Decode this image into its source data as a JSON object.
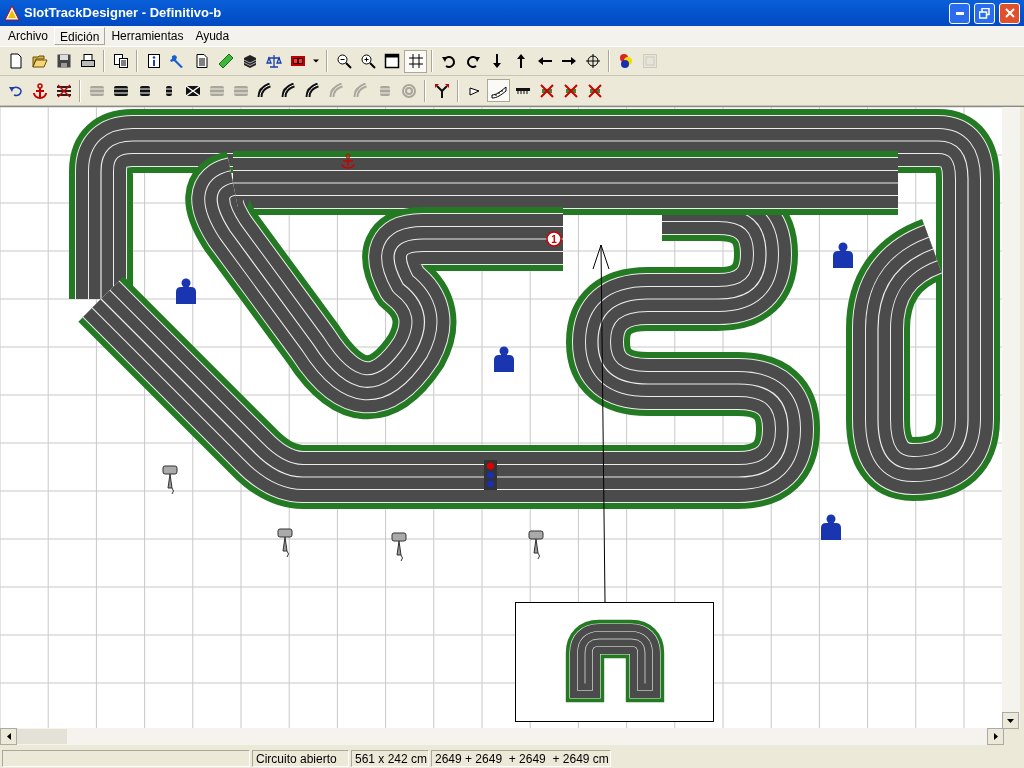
{
  "window": {
    "title": "SlotTrackDesigner - Definitivo-b"
  },
  "menu": [
    {
      "label": "Archivo",
      "selected": false
    },
    {
      "label": "Edición",
      "selected": true
    },
    {
      "label": "Herramientas",
      "selected": false
    },
    {
      "label": "Ayuda",
      "selected": false
    }
  ],
  "toolbars": [
    [
      {
        "kind": "new",
        "disabled": false,
        "selected": false
      },
      {
        "kind": "open",
        "disabled": false,
        "selected": false
      },
      {
        "kind": "save",
        "disabled": false,
        "selected": false
      },
      {
        "kind": "print",
        "disabled": false,
        "selected": false
      },
      {
        "kind": "separator"
      },
      {
        "kind": "copy",
        "disabled": false,
        "selected": false
      },
      {
        "kind": "separator"
      },
      {
        "kind": "info",
        "disabled": false,
        "selected": false
      },
      {
        "kind": "wrench",
        "disabled": false,
        "selected": false
      },
      {
        "kind": "document",
        "disabled": false,
        "selected": false
      },
      {
        "kind": "ruler",
        "disabled": false,
        "selected": false
      },
      {
        "kind": "layers",
        "disabled": false,
        "selected": false
      },
      {
        "kind": "scales",
        "disabled": false,
        "selected": false
      },
      {
        "kind": "timer",
        "disabled": false,
        "selected": false
      },
      {
        "kind": "dropdown",
        "disabled": false,
        "selected": false
      },
      {
        "kind": "separator"
      },
      {
        "kind": "zoom-out",
        "disabled": false,
        "selected": false
      },
      {
        "kind": "zoom-in",
        "disabled": false,
        "selected": false
      },
      {
        "kind": "window",
        "disabled": false,
        "selected": false
      },
      {
        "kind": "grid",
        "disabled": false,
        "selected": true
      },
      {
        "kind": "separator"
      },
      {
        "kind": "rotate-left",
        "disabled": false,
        "selected": false
      },
      {
        "kind": "rotate-right",
        "disabled": false,
        "selected": false
      },
      {
        "kind": "down",
        "disabled": false,
        "selected": false
      },
      {
        "kind": "up",
        "disabled": false,
        "selected": false
      },
      {
        "kind": "left",
        "disabled": false,
        "selected": false
      },
      {
        "kind": "right",
        "disabled": false,
        "selected": false
      },
      {
        "kind": "crosshair",
        "disabled": false,
        "selected": false
      },
      {
        "kind": "separator"
      },
      {
        "kind": "colors",
        "disabled": false,
        "selected": false
      },
      {
        "kind": "picture",
        "disabled": true,
        "selected": false
      }
    ],
    [
      {
        "kind": "undo",
        "disabled": false,
        "selected": false
      },
      {
        "kind": "anchor",
        "disabled": false,
        "selected": false
      },
      {
        "kind": "crossed",
        "disabled": false,
        "selected": false
      },
      {
        "kind": "separator"
      },
      {
        "kind": "lanes",
        "disabled": true,
        "selected": false
      },
      {
        "kind": "lanes",
        "disabled": false,
        "selected": false
      },
      {
        "kind": "lanes-narrow",
        "disabled": false,
        "selected": false
      },
      {
        "kind": "lanes-thin",
        "disabled": false,
        "selected": false
      },
      {
        "kind": "crossover",
        "disabled": false,
        "selected": false
      },
      {
        "kind": "lanes",
        "disabled": true,
        "selected": false
      },
      {
        "kind": "lanes",
        "disabled": true,
        "selected": false
      },
      {
        "kind": "curve",
        "disabled": false,
        "selected": false
      },
      {
        "kind": "curve",
        "disabled": false,
        "selected": false
      },
      {
        "kind": "curve",
        "disabled": false,
        "selected": false
      },
      {
        "kind": "curve",
        "disabled": true,
        "selected": false
      },
      {
        "kind": "curve",
        "disabled": true,
        "selected": false
      },
      {
        "kind": "lanes-narrow",
        "disabled": true,
        "selected": false
      },
      {
        "kind": "circles",
        "disabled": true,
        "selected": false
      },
      {
        "kind": "separator"
      },
      {
        "kind": "fork",
        "disabled": false,
        "selected": false
      },
      {
        "kind": "separator"
      },
      {
        "kind": "pennant",
        "disabled": false,
        "selected": false
      },
      {
        "kind": "measure",
        "disabled": false,
        "selected": true
      },
      {
        "kind": "barrier",
        "disabled": false,
        "selected": false
      },
      {
        "kind": "delete",
        "disabled": false,
        "selected": false
      },
      {
        "kind": "delete",
        "disabled": false,
        "selected": false
      },
      {
        "kind": "delete",
        "disabled": false,
        "selected": false
      }
    ]
  ],
  "canvas": {
    "start_marker": "1"
  },
  "status_bar": [
    "Circuito abierto",
    "561 x 242 cm",
    "2649 + 2649  + 2649  + 2649 cm"
  ]
}
